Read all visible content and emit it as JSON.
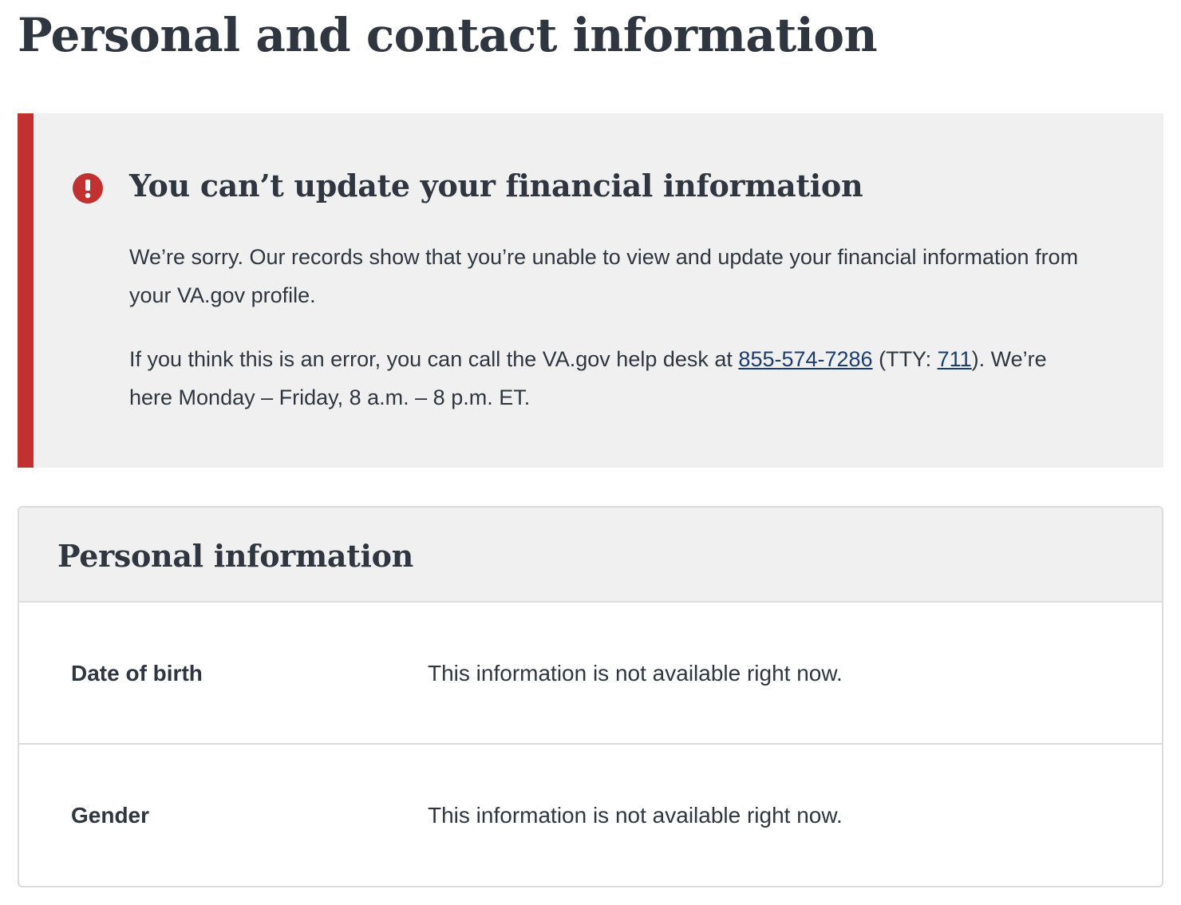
{
  "page": {
    "title": "Personal and contact information"
  },
  "alert": {
    "status": "error",
    "accent_color": "#c0312f",
    "icon": "error-exclamation-icon",
    "heading": "You can’t update your financial information",
    "paragraph1": "We’re sorry. Our records show that you’re unable to view and update your financial information from your VA.gov profile.",
    "paragraph2_before": "If you think this is an error, you can call the VA.gov help desk at ",
    "phone_link": "855-574-7286",
    "paragraph2_middle": " (TTY: ",
    "tty_link": "711",
    "paragraph2_after": "). We’re here Monday – Friday, 8 a.m. – 8 p.m. ET."
  },
  "personal_info": {
    "title": "Personal information",
    "rows": [
      {
        "label": "Date of birth",
        "value": "This information is not available right now."
      },
      {
        "label": "Gender",
        "value": "This information is not available right now."
      }
    ]
  }
}
